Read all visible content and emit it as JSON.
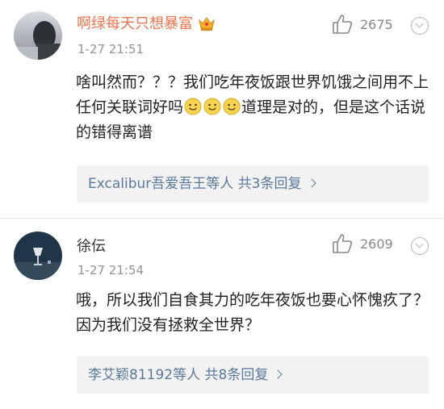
{
  "comments": [
    {
      "username": "啊绿每天只想暴富",
      "username_color": "#eb7350",
      "time": "1-27 21:51",
      "likes": "2675",
      "text_parts": [
        "啥叫然而？？？我们吃年夜饭跟世界饥饿之间用不上任何关联词好吗",
        "道理是对的，但是这个话说的错得离谱"
      ],
      "emoji": "smile-emoji",
      "emoji_count": 3,
      "replies": {
        "names": "Excalibur吾爱吾王",
        "suffix": "等人",
        "count": "共3条回复"
      }
    },
    {
      "username": "徐伝",
      "username_color": "#333333",
      "time": "1-27 21:54",
      "likes": "2609",
      "text": "哦，所以我们自食其力的吃年夜饭也要心怀愧疚了？因为我们没有拯救全世界？",
      "replies": {
        "names": "李艾颖81192",
        "suffix": "等人",
        "count": "共8条回复"
      }
    }
  ],
  "icons": {
    "like": "thumbs-up-icon",
    "more": "chevron-down-circle-icon",
    "vip": "crown-badge-icon",
    "reply_arrow": "chevron-right-icon"
  }
}
